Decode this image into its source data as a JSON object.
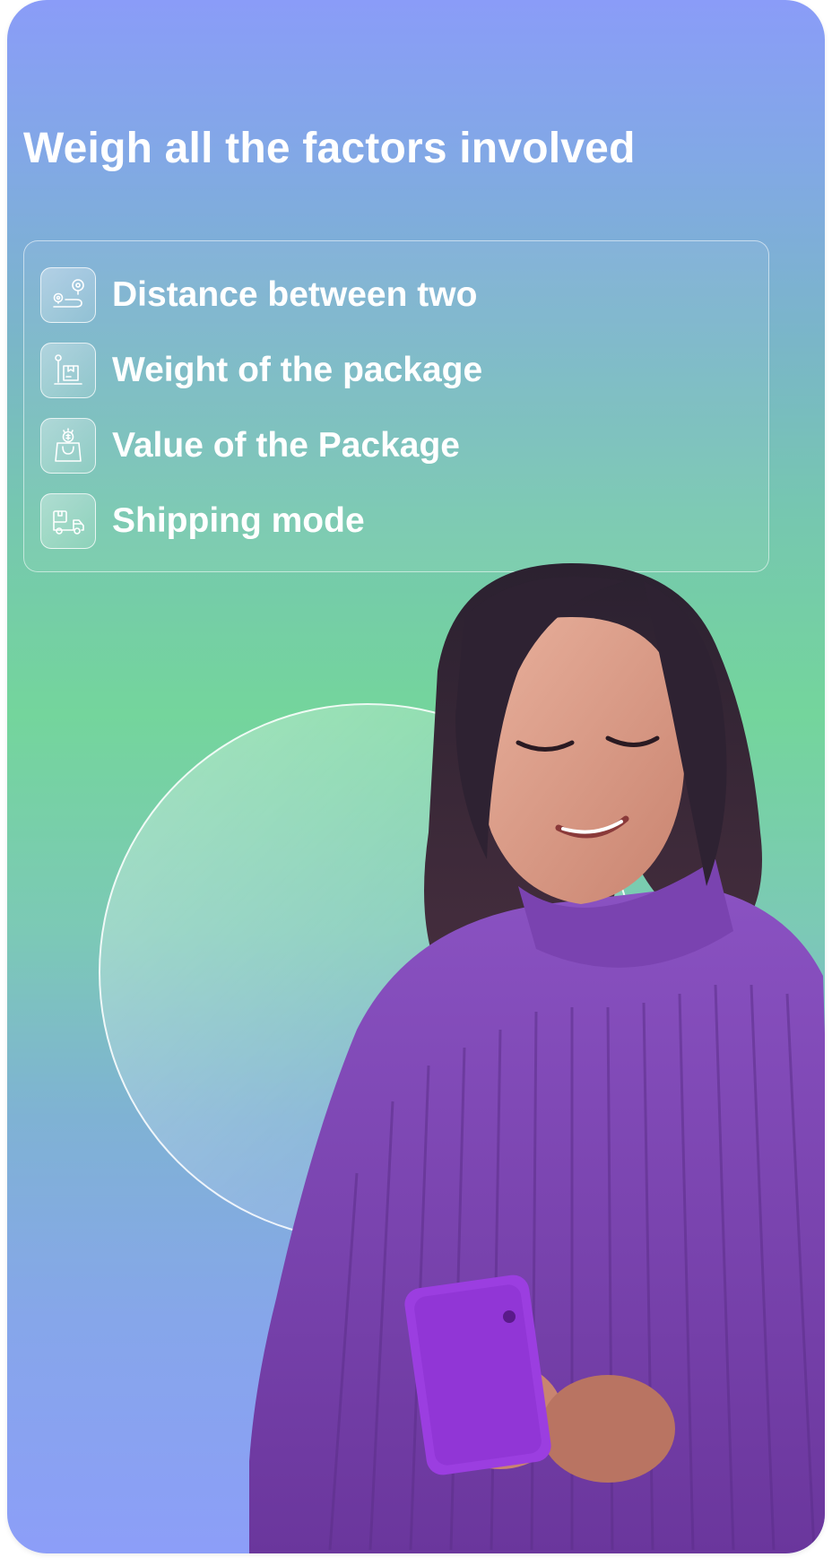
{
  "headline": "Weigh all the factors involved",
  "factors": [
    {
      "label": "Distance between two",
      "icon": "route-map-icon"
    },
    {
      "label": "Weight of the package",
      "icon": "package-scale-icon"
    },
    {
      "label": "Value of the Package",
      "icon": "shopping-bag-value-icon"
    },
    {
      "label": "Shipping mode",
      "icon": "delivery-truck-icon"
    }
  ],
  "colors": {
    "gradient_top": "#8a9cf8",
    "gradient_mid": "#74d59c",
    "gradient_bottom": "#8c9ef8",
    "text": "#ffffff",
    "sweater": "#7a43b0",
    "phone": "#9b3ee0"
  }
}
